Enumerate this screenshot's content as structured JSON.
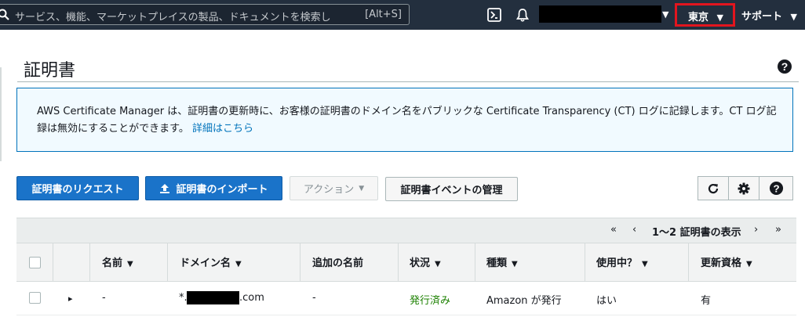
{
  "topbar": {
    "search_placeholder": "サービス、機能、マーケットプレイスの製品、ドキュメントを検索し",
    "search_shortcut": "[Alt+S]",
    "region_label": "東京",
    "support_label": "サポート",
    "caret": "▼"
  },
  "page": {
    "title": "証明書"
  },
  "info": {
    "text": "AWS Certificate Manager は、証明書の更新時に、お客様の証明書のドメイン名をパブリックな Certificate Transparency (CT) ログに記録します。CT ログ記録は無効にすることができます。",
    "link": "詳細はこちら"
  },
  "toolbar": {
    "request_label": "証明書のリクエスト",
    "import_label": "証明書のインポート",
    "actions_label": "アクション",
    "events_label": "証明書イベントの管理"
  },
  "pager": {
    "first": "«",
    "prev": "‹",
    "text": "1〜2 証明書の表示",
    "next": "›",
    "last": "»"
  },
  "table": {
    "columns": [
      "名前",
      "ドメイン名",
      "追加の名前",
      "状況",
      "種類",
      "使用中？",
      "更新資格"
    ],
    "rows": [
      {
        "expand": "▸",
        "name": "-",
        "domain_prefix": "*.",
        "domain_suffix": ".com",
        "additional": "-",
        "status": "発行済み",
        "type": "Amazon が発行",
        "in_use": "はい",
        "renewal": "有"
      }
    ]
  },
  "colors": {
    "nav_bg": "#232f3e",
    "primary": "#1a73c9",
    "info_border": "#0073bb",
    "info_bg": "#f1faff",
    "highlight": "#e3151e",
    "status_ok": "#1d8102"
  }
}
